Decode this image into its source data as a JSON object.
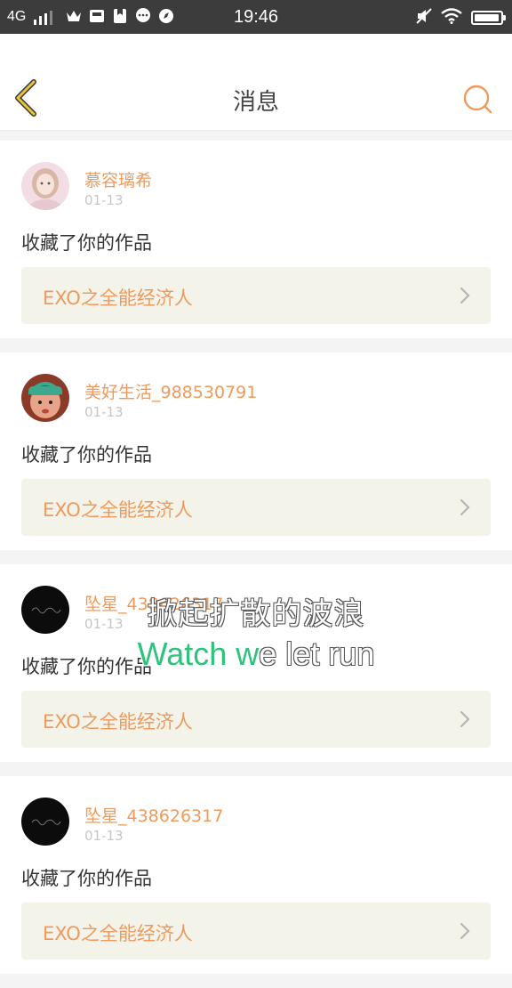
{
  "status_bar": {
    "network": "4G",
    "time": "19:46",
    "battery_level": 0.95,
    "notification_icons": [
      "crown-icon",
      "gallery-icon",
      "bookmark-icon",
      "chat-icon",
      "compass-icon"
    ]
  },
  "header": {
    "title": "消息",
    "back_icon": "chevron-left-icon",
    "search_icon": "search-icon"
  },
  "messages": [
    {
      "user": "慕容璃希",
      "date": "01-13",
      "action": "收藏了你的作品",
      "work": "EXO之全能经济人",
      "avatar": "girl"
    },
    {
      "user": "美好生活_988530791",
      "date": "01-13",
      "action": "收藏了你的作品",
      "work": "EXO之全能经济人",
      "avatar": "baby"
    },
    {
      "user": "坠星_438626317",
      "date": "01-13",
      "action": "收藏了你的作品",
      "work": "EXO之全能经济人",
      "avatar": "dark"
    },
    {
      "user": "坠星_438626317",
      "date": "01-13",
      "action": "收藏了你的作品",
      "work": "EXO之全能经济人",
      "avatar": "dark"
    }
  ],
  "lyrics": {
    "line1": "掀起扩散的波浪",
    "line2_sung": "Watch w",
    "line2_unsung": "e let run"
  },
  "colors": {
    "accent": "#ee9a5c",
    "back_chevron": "#e8c53a",
    "lyric_sung": "#2ec27a"
  }
}
